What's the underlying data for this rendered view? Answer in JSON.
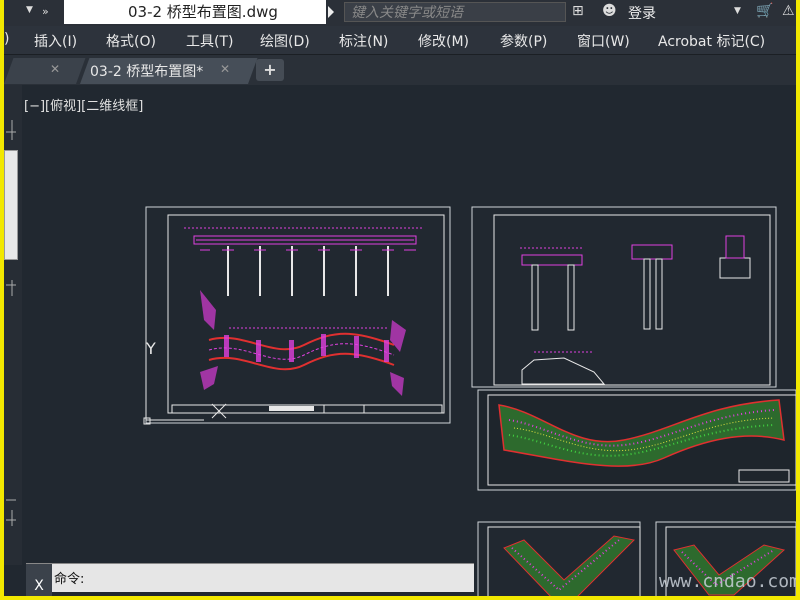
{
  "titlebar": {
    "document_title": "03-2 桥型布置图.dwg",
    "search_placeholder": "键入关键字或短语",
    "login_label": "登录"
  },
  "menu": {
    "items": [
      "插入(I)",
      "格式(O)",
      "工具(T)",
      "绘图(D)",
      "标注(N)",
      "修改(M)",
      "参数(P)",
      "窗口(W)",
      "Acrobat 标记(C)"
    ]
  },
  "tabs": {
    "active_label": "03-2 桥型布置图*",
    "new_tab_label": "+"
  },
  "viewport": {
    "view_label": "[−][俯视][二维线框]",
    "ucs_y_label": "Y"
  },
  "command": {
    "prompt": "命令:",
    "close_label": "X"
  },
  "watermark": "www.cndao.com"
}
